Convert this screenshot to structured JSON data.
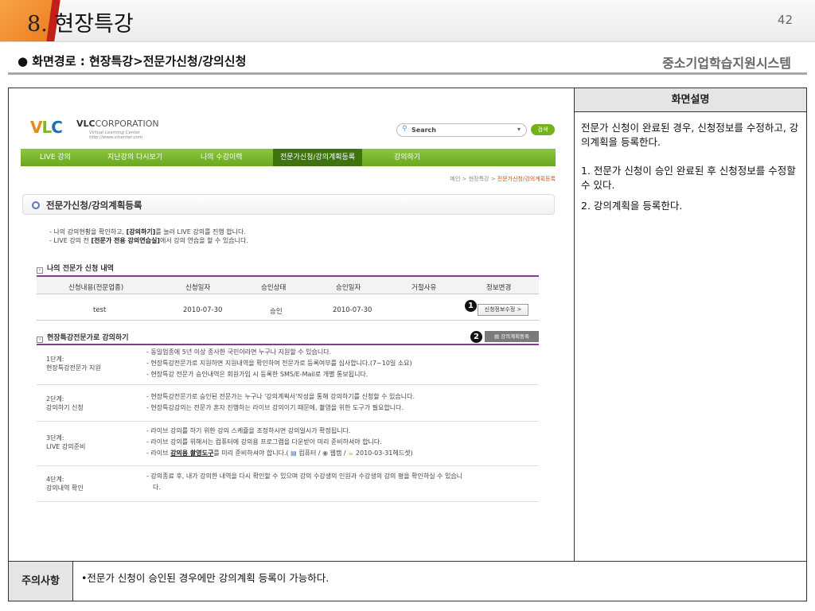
{
  "header": {
    "number": "8.",
    "title": "현장특강",
    "page_number": "42"
  },
  "route": "● 화면경로 : 현장특강>전문가신청/강의신청",
  "system_name": "중소기업학습지원시스템",
  "description": {
    "heading": "화면설명",
    "lines": [
      "전문가 신청이 완료된 경우, 신청정보를 수정하고, 강의계획을 등록한다.",
      "1. 전문가 신청이 승인 완료된 후 신청정보를 수정할 수 있다.",
      "2. 강의계획을 등록한다."
    ]
  },
  "note": {
    "label": "주의사항",
    "text": "•전문가 신청이 승인된 경우에만 강의계획 등록이 가능하다."
  },
  "site": {
    "logo": {
      "v": "V",
      "l": "L",
      "c": "C",
      "corp_bold": "VLC",
      "corp": "CORPORATION",
      "sub1": "Virtual Learning Center",
      "sub2": "http://www.vlcenter.com"
    },
    "search": {
      "icon": "search-icon",
      "label": "Search",
      "button": "검색"
    },
    "nav": [
      "LIVE 강의",
      "지난강의 다시보기",
      "나의 수강이력",
      "전문가신청/강의계획등록",
      "강의하기"
    ],
    "breadcrumb": {
      "prefix": "메인 > 현장특강 > ",
      "current": "전문가신청/강의계획등록"
    },
    "section_title": "전문가신청/강의계획등록",
    "intro": {
      "l1a": "- 나의 강의현황을 확인하고, ",
      "l1b": "[강의하기]",
      "l1c": "를 눌러 LIVE 강의를 진행 합니다.",
      "l2a": "- LIVE 강의 전 ",
      "l2b": "[전문가 전용 강의연습실]",
      "l2c": "에서 강의 연습을 할 수 있습니다."
    },
    "apply_heading": "나의 전문가 신청 내역",
    "apply_table": {
      "headers": [
        "신청내용(전문업종)",
        "신청일자",
        "승인상태",
        "승인일자",
        "거절사유",
        "정보변경"
      ],
      "row": [
        "test",
        "2010-07-30",
        "승인",
        "2010-07-30",
        ""
      ],
      "edit_button": "신청정보수정 >"
    },
    "lecture_heading": "현장특강전문가로 강의하기",
    "plan_button": "강의계획등록",
    "badges": [
      "1",
      "2"
    ],
    "steps": [
      {
        "step": "1단계:",
        "name": "현장특강전문가 지원",
        "lines": [
          "- 동일업종에 5년 이상 종사한 국민이라면 누구나 지원할 수 있습니다.",
          "- 현장특강전문가로 지원하면 지원내역을 확인하여 전문가로 등록여부를 심사합니다.(7~10일 소요)",
          "- 현장특강 전문가 승인내역은 회원가입 시 등록한 SMS/E-Mail로 개별 통보됩니다."
        ]
      },
      {
        "step": "2단계:",
        "name": "강의하기 신청",
        "lines": [
          "- 현장특강전문가로 승인된 전문가는 누구나 '강의계획서'작성을 통해 강의하기를 신청할 수 있습니다.",
          "- 현장특강강의는 전문가 혼자 진행하는 라이브 강의이기 때문에, 촬영을 위한 도구가 필요합니다."
        ]
      },
      {
        "step": "3단계:",
        "name": "LIVE 강의준비",
        "lines": [
          "- 라이브 강의를 하기 위한 강의 스케쥴을 조정하시면 강의일시가 확정됩니다.",
          "- 라이브 강의를 위해서는 컴퓨터에 강의용 프로그램을 다운받아 미리 준비하셔야 합니다."
        ],
        "l3a": "- 라이브 ",
        "l3b": "강의용 촬영도구",
        "l3c": "를 미리 준비하셔야 합니다.( ",
        "l3d": " 컴퓨터 / ",
        "l3e": " 웹캠 / ",
        "l3f": " 2010-03-31헤드셋)"
      },
      {
        "step": "4단계:",
        "name": "강의내역 확인",
        "lines": [
          "- 강의종료 후, 내가 강의한 내역을 다시 확인할 수 있으며 강의 수강생의 인원과 수강생의 강의 평을 확인하실 수 있습니",
          "다."
        ]
      }
    ]
  }
}
